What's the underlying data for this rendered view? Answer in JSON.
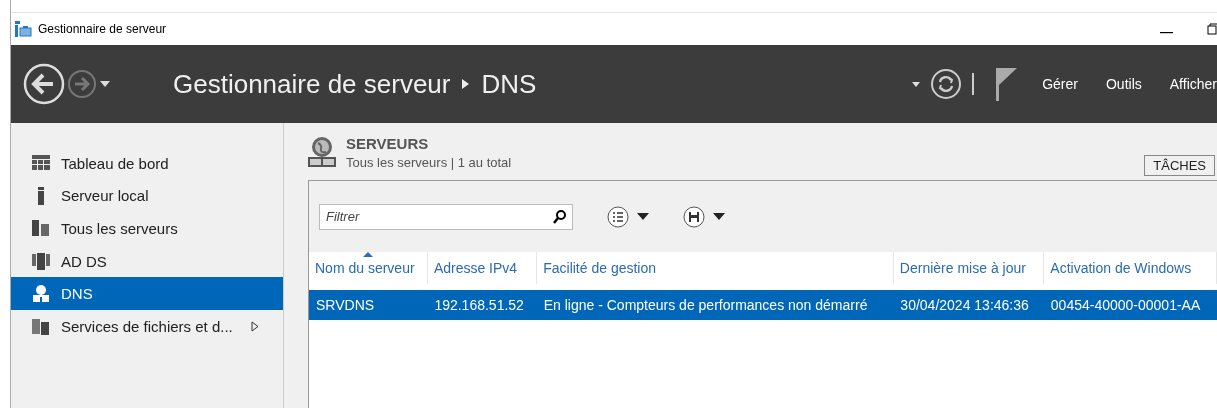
{
  "window": {
    "title": "Gestionnaire de serveur"
  },
  "header": {
    "breadcrumb": [
      "Gestionnaire de serveur",
      "DNS"
    ],
    "menu": [
      "Gérer",
      "Outils",
      "Afficher"
    ]
  },
  "sidebar": {
    "items": [
      {
        "label": "Tableau de bord",
        "kind": "dashboard",
        "selected": false,
        "expandable": false
      },
      {
        "label": "Serveur local",
        "kind": "server",
        "selected": false,
        "expandable": false
      },
      {
        "label": "Tous les serveurs",
        "kind": "servers",
        "selected": false,
        "expandable": false
      },
      {
        "label": "AD DS",
        "kind": "role",
        "selected": false,
        "expandable": false
      },
      {
        "label": "DNS",
        "kind": "dns",
        "selected": true,
        "expandable": false
      },
      {
        "label": "Services de fichiers et d...",
        "kind": "files",
        "selected": false,
        "expandable": true
      }
    ]
  },
  "section": {
    "title": "SERVEURS",
    "subtitle": "Tous les serveurs | 1 au total",
    "tasks_button": "TÂCHES"
  },
  "filter": {
    "placeholder": "Filtrer"
  },
  "table": {
    "columns": [
      {
        "label": "Nom du serveur",
        "sorted": true
      },
      {
        "label": "Adresse IPv4",
        "sorted": false
      },
      {
        "label": "Facilité de gestion",
        "sorted": false
      },
      {
        "label": "Dernière mise à jour",
        "sorted": false
      },
      {
        "label": "Activation de Windows",
        "sorted": false
      }
    ],
    "rows": [
      {
        "selected": true,
        "cells": [
          "SRVDNS",
          "192.168.51.52",
          "En ligne - Compteurs de performances non démarré",
          "30/04/2024 13:46:36",
          "00454-40000-00001-AA"
        ]
      }
    ]
  }
}
